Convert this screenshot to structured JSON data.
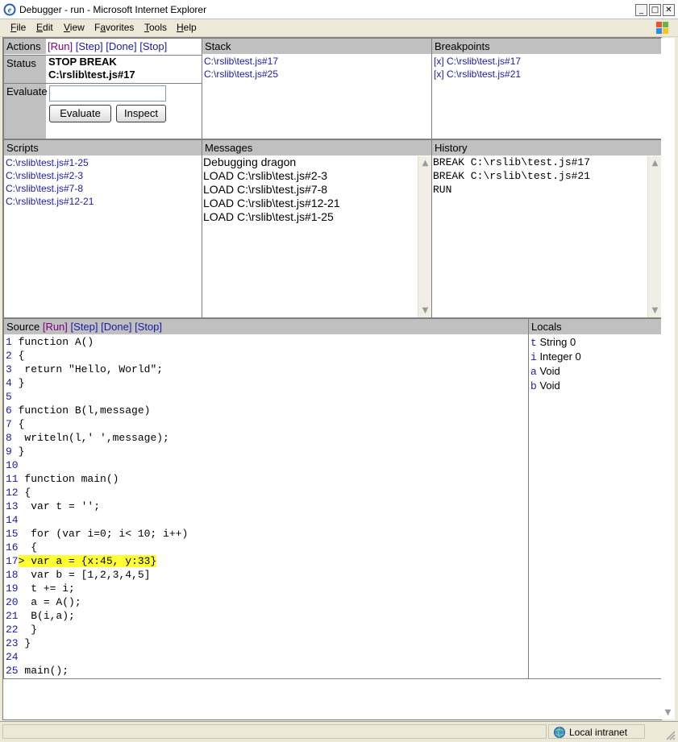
{
  "window": {
    "title": "Debugger - run - Microsoft Internet Explorer"
  },
  "menu": [
    {
      "label": "File",
      "mnemonic": "F",
      "rest": "ile"
    },
    {
      "label": "Edit",
      "mnemonic": "E",
      "rest": "dit"
    },
    {
      "label": "View",
      "mnemonic": "V",
      "rest": "iew"
    },
    {
      "label": "Favorites",
      "mnemonic": "a",
      "pre": "F",
      "rest": "vorites"
    },
    {
      "label": "Tools",
      "mnemonic": "T",
      "rest": "ools"
    },
    {
      "label": "Help",
      "mnemonic": "H",
      "rest": "elp"
    }
  ],
  "actions": {
    "label": "Actions",
    "run": "[Run]",
    "step": "[Step]",
    "done": "[Done]",
    "stop": "[Stop]"
  },
  "status": {
    "label": "Status",
    "line1": "STOP BREAK",
    "line2": "C:\\rslib\\test.js#17"
  },
  "evaluate": {
    "label": "Evaluate",
    "input_value": "",
    "evaluate_button": "Evaluate",
    "inspect_button": "Inspect"
  },
  "stack": {
    "label": "Stack",
    "items": [
      "C:\\rslib\\test.js#17",
      "C:\\rslib\\test.js#25"
    ]
  },
  "breakpoints": {
    "label": "Breakpoints",
    "items": [
      "[x] C:\\rslib\\test.js#17",
      "[x] C:\\rslib\\test.js#21"
    ]
  },
  "scripts": {
    "label": "Scripts",
    "items": [
      "C:\\rslib\\test.js#1-25",
      "C:\\rslib\\test.js#2-3",
      "C:\\rslib\\test.js#7-8",
      "C:\\rslib\\test.js#12-21"
    ]
  },
  "messages": {
    "label": "Messages",
    "items": [
      "Debugging dragon",
      "LOAD C:\\rslib\\test.js#2-3",
      "LOAD C:\\rslib\\test.js#7-8",
      "LOAD C:\\rslib\\test.js#12-21",
      "LOAD C:\\rslib\\test.js#1-25"
    ]
  },
  "history": {
    "label": "History",
    "items": [
      "BREAK C:\\rslib\\test.js#17",
      "BREAK C:\\rslib\\test.js#21",
      "RUN"
    ]
  },
  "source": {
    "label": "Source",
    "run": "[Run]",
    "step": "[Step]",
    "done": "[Done]",
    "stop": "[Stop]",
    "lines": [
      {
        "n": "1",
        "code": " function A()"
      },
      {
        "n": "2",
        "code": " {"
      },
      {
        "n": "3",
        "code": "  return \"Hello, World\";"
      },
      {
        "n": "4",
        "code": " }"
      },
      {
        "n": "5",
        "code": ""
      },
      {
        "n": "6",
        "code": " function B(l,message)"
      },
      {
        "n": "7",
        "code": " {"
      },
      {
        "n": "8",
        "code": "  writeln(l,' ',message);"
      },
      {
        "n": "9",
        "code": " }"
      },
      {
        "n": "10",
        "code": ""
      },
      {
        "n": "11",
        "code": " function main()"
      },
      {
        "n": "12",
        "code": " {"
      },
      {
        "n": "13",
        "code": "  var t = '';"
      },
      {
        "n": "14",
        "code": ""
      },
      {
        "n": "15",
        "code": "  for (var i=0; i< 10; i++)"
      },
      {
        "n": "16",
        "code": "  {"
      },
      {
        "n": "17",
        "code": "> var a = {x:45, y:33}",
        "current": true
      },
      {
        "n": "18",
        "code": "  var b = [1,2,3,4,5]"
      },
      {
        "n": "19",
        "code": "  t += i;"
      },
      {
        "n": "20",
        "code": "  a = A();"
      },
      {
        "n": "21",
        "code": "  B(i,a);"
      },
      {
        "n": "22",
        "code": "  }"
      },
      {
        "n": "23",
        "code": " }"
      },
      {
        "n": "24",
        "code": ""
      },
      {
        "n": "25",
        "code": " main();"
      }
    ]
  },
  "locals": {
    "label": "Locals",
    "items": [
      {
        "name": "t",
        "value": "String 0"
      },
      {
        "name": "i",
        "value": "Integer 0"
      },
      {
        "name": "a",
        "value": "Void"
      },
      {
        "name": "b",
        "value": "Void"
      }
    ]
  },
  "statusbar": {
    "zone": "Local intranet"
  },
  "colors": {
    "link": "#1a1aa6",
    "visited": "#800080",
    "highlight": "#ffff33",
    "header": "#c0c0c0"
  }
}
